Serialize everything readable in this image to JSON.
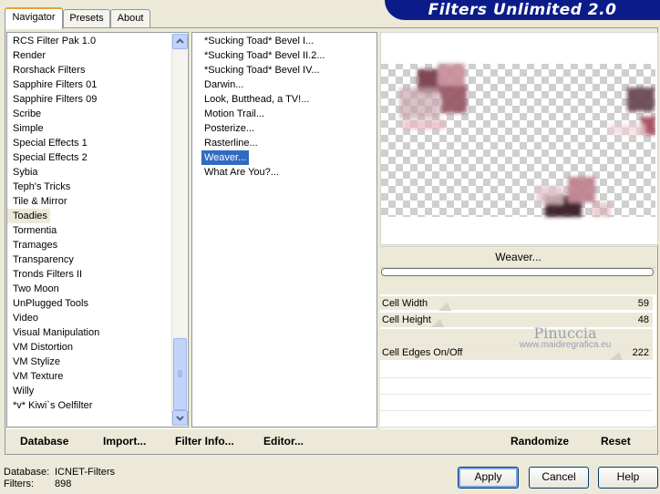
{
  "tabs": [
    "Navigator",
    "Presets",
    "About"
  ],
  "banner_title": "Filters Unlimited 2.0",
  "categories": [
    "RCS Filter Pak 1.0",
    "Render",
    "Rorshack Filters",
    "Sapphire Filters 01",
    "Sapphire Filters 09",
    "Scribe",
    "Simple",
    "Special Effects 1",
    "Special Effects 2",
    "Sybia",
    "Teph's Tricks",
    "Tile & Mirror",
    "Toadies",
    "Tormentia",
    "Tramages",
    "Transparency",
    "Tronds Filters II",
    "Two Moon",
    "UnPlugged Tools",
    "Video",
    "Visual Manipulation",
    "VM Distortion",
    "VM Stylize",
    "VM Texture",
    "Willy",
    "*v* Kiwi`s Oelfilter"
  ],
  "selected_category": "Toadies",
  "filters": [
    "*Sucking Toad*  Bevel I...",
    "*Sucking Toad*  Bevel II.2...",
    "*Sucking Toad*  Bevel IV...",
    "Darwin...",
    "Look, Butthead, a TV!...",
    "Motion Trail...",
    "Posterize...",
    "Rasterline...",
    "Weaver...",
    "What Are You?..."
  ],
  "selected_filter": "Weaver...",
  "filter_name": "Weaver...",
  "params": [
    {
      "label": "Cell Width",
      "value": "59"
    },
    {
      "label": "Cell Height",
      "value": "48"
    },
    {
      "label": "Cell Edges On/Off",
      "value": "222"
    }
  ],
  "watermark": {
    "name": "Pinuccia",
    "site": "www.maidiregrafica.eu"
  },
  "toolbar": {
    "database": "Database",
    "import": "Import...",
    "filter_info": "Filter Info...",
    "editor": "Editor...",
    "randomize": "Randomize",
    "reset": "Reset"
  },
  "status": {
    "database_label": "Database:",
    "database_value": "ICNET-Filters",
    "filters_label": "Filters:",
    "filters_value": "898"
  },
  "buttons": {
    "apply": "Apply",
    "cancel": "Cancel",
    "help": "Help"
  },
  "colors": {
    "banner": "#0b1c8a",
    "selection": "#316ac5",
    "accent_tab": "#e8a13a",
    "tile_color": "#b06876"
  }
}
